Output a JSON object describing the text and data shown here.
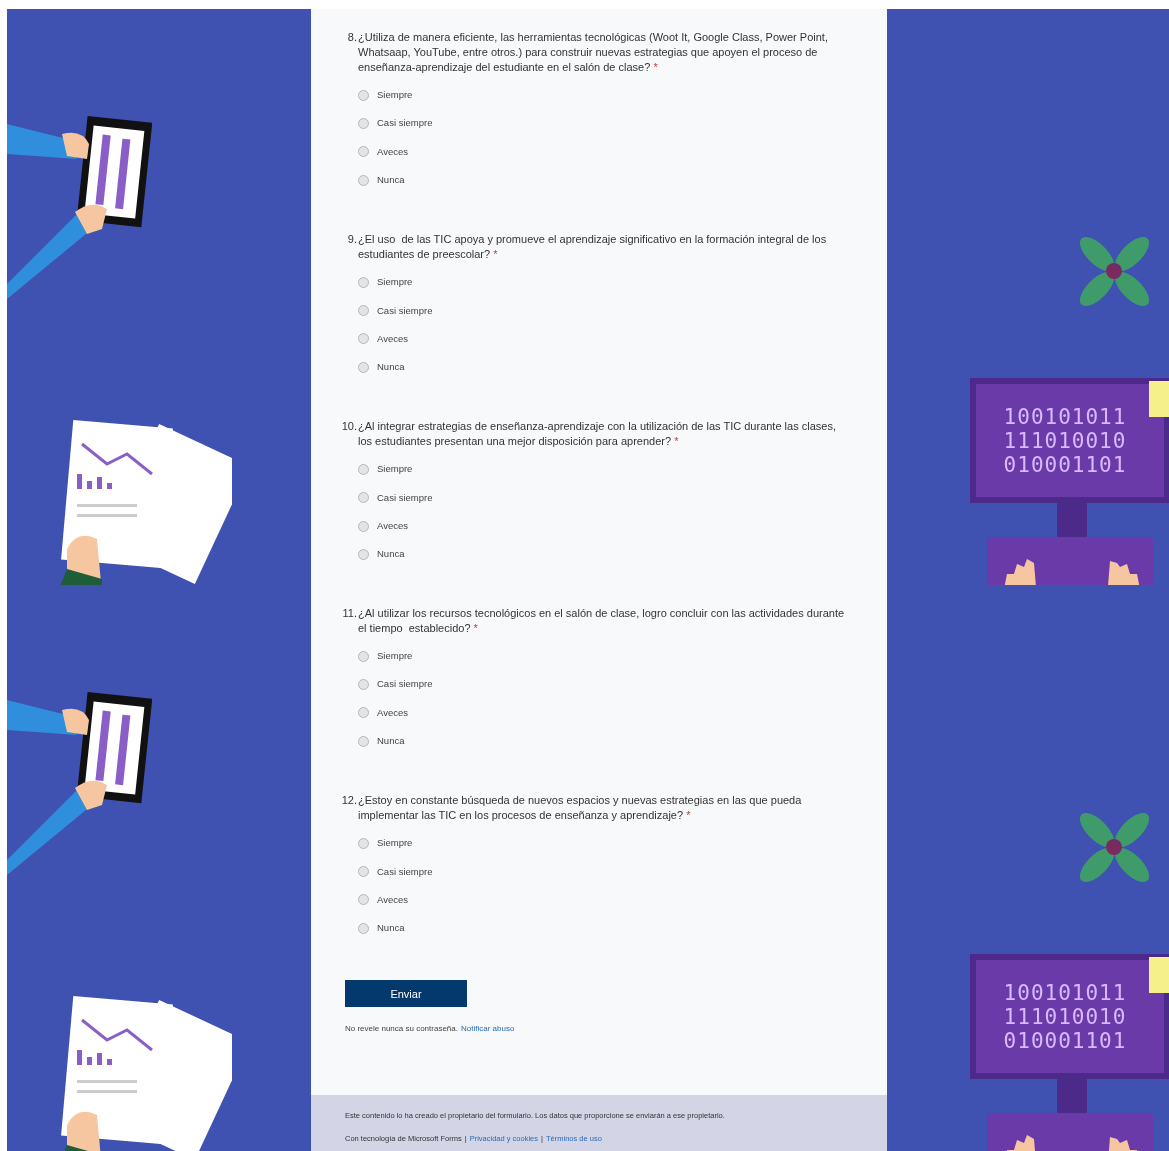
{
  "panels": [
    {
      "questions": [
        {
          "number": "8.",
          "text": "¿Utiliza de manera eficiente, las herramientas tecnológicas (Woot It, Google Class, Power Point, Whatsaap, YouTube, entre otros.) para construir nuevas estrategias que apoyen el proceso de enseñanza-aprendizaje del estudiante en el salón de clase?",
          "required_mark": "*",
          "options": [
            {
              "label": "Siempre",
              "selected": false
            },
            {
              "label": "Casi siempre",
              "selected": false
            },
            {
              "label": "Aveces",
              "selected": false
            },
            {
              "label": "Nunca",
              "selected": false
            }
          ]
        },
        {
          "number": "9.",
          "text": "¿El uso  de las TIC apoya y promueve el aprendizaje significativo en la formación integral de los estudiantes de preescolar?",
          "required_mark": "*",
          "options": [
            {
              "label": "Siempre",
              "selected": false
            },
            {
              "label": "Casi siempre",
              "selected": false
            },
            {
              "label": "Aveces",
              "selected": false
            },
            {
              "label": "Nunca",
              "selected": false
            }
          ]
        },
        {
          "number": "10.",
          "text": "¿Al integrar estrategias de enseñanza-aprendizaje con la utilización de las TIC durante las clases, los estudiantes presentan una mejor disposición para aprender?",
          "required_mark": "*",
          "options": [
            {
              "label": "Siempre",
              "selected": false
            },
            {
              "label": "Casi siempre",
              "selected": false
            },
            {
              "label": "Aveces",
              "selected": false
            },
            {
              "label": "Nunca",
              "selected": false
            }
          ]
        }
      ],
      "monitor_lines": [
        "100101011",
        "111010010",
        "010001101"
      ]
    },
    {
      "questions": [
        {
          "number": "11.",
          "text": "¿Al utilizar los recursos tecnológicos en el salón de clase, logro concluir con las actividades durante el tiempo  establecido?",
          "required_mark": "*",
          "options": [
            {
              "label": "Siempre",
              "selected": false
            },
            {
              "label": "Casi siempre",
              "selected": false
            },
            {
              "label": "Aveces",
              "selected": false
            },
            {
              "label": "Nunca",
              "selected": false
            }
          ]
        },
        {
          "number": "12.",
          "text": "¿Estoy en constante búsqueda de nuevos espacios y nuevas estrategias en las que pueda implementar las TIC en los procesos de enseñanza y aprendizaje?",
          "required_mark": "*",
          "options": [
            {
              "label": "Siempre",
              "selected": false
            },
            {
              "label": "Casi siempre",
              "selected": false
            },
            {
              "label": "Aveces",
              "selected": false
            },
            {
              "label": "Nunca",
              "selected": false
            }
          ]
        }
      ],
      "submit": "Enviar",
      "notice": {
        "text": "No revele nunca su contraseña.",
        "link": "Notificar abuso"
      },
      "footer": {
        "text": "Este contenido lo ha creado el propietario del formulario. Los datos que proporcione se enviarán a ese propietario.",
        "powered": "Con tecnología de Microsoft Forms",
        "separator": "|",
        "links": [
          "Privacidad y cookies",
          "Términos de uso"
        ]
      },
      "monitor_lines": [
        "100101011",
        "111010010",
        "010001101"
      ]
    }
  ]
}
